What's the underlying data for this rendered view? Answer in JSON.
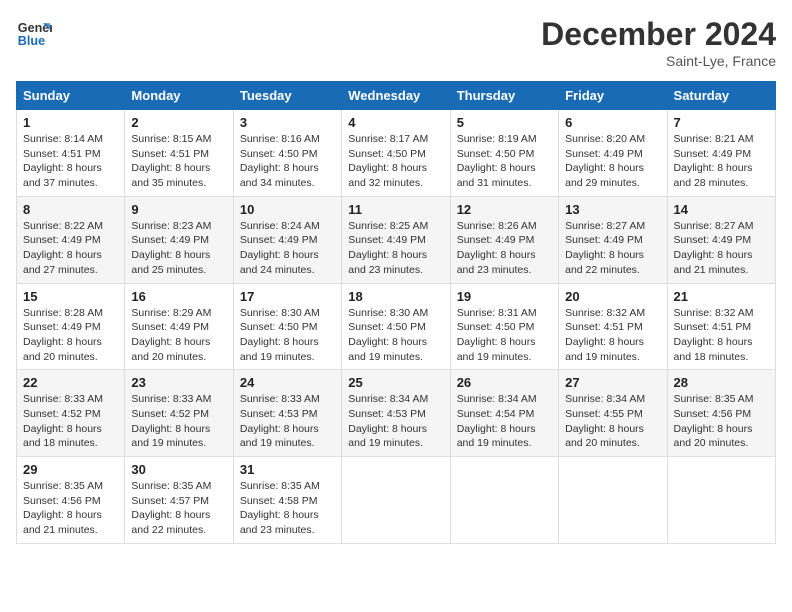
{
  "header": {
    "logo_line1": "General",
    "logo_line2": "Blue",
    "month": "December 2024",
    "location": "Saint-Lye, France"
  },
  "columns": [
    "Sunday",
    "Monday",
    "Tuesday",
    "Wednesday",
    "Thursday",
    "Friday",
    "Saturday"
  ],
  "weeks": [
    [
      {
        "day": "1",
        "lines": [
          "Sunrise: 8:14 AM",
          "Sunset: 4:51 PM",
          "Daylight: 8 hours",
          "and 37 minutes."
        ]
      },
      {
        "day": "2",
        "lines": [
          "Sunrise: 8:15 AM",
          "Sunset: 4:51 PM",
          "Daylight: 8 hours",
          "and 35 minutes."
        ]
      },
      {
        "day": "3",
        "lines": [
          "Sunrise: 8:16 AM",
          "Sunset: 4:50 PM",
          "Daylight: 8 hours",
          "and 34 minutes."
        ]
      },
      {
        "day": "4",
        "lines": [
          "Sunrise: 8:17 AM",
          "Sunset: 4:50 PM",
          "Daylight: 8 hours",
          "and 32 minutes."
        ]
      },
      {
        "day": "5",
        "lines": [
          "Sunrise: 8:19 AM",
          "Sunset: 4:50 PM",
          "Daylight: 8 hours",
          "and 31 minutes."
        ]
      },
      {
        "day": "6",
        "lines": [
          "Sunrise: 8:20 AM",
          "Sunset: 4:49 PM",
          "Daylight: 8 hours",
          "and 29 minutes."
        ]
      },
      {
        "day": "7",
        "lines": [
          "Sunrise: 8:21 AM",
          "Sunset: 4:49 PM",
          "Daylight: 8 hours",
          "and 28 minutes."
        ]
      }
    ],
    [
      {
        "day": "8",
        "lines": [
          "Sunrise: 8:22 AM",
          "Sunset: 4:49 PM",
          "Daylight: 8 hours",
          "and 27 minutes."
        ]
      },
      {
        "day": "9",
        "lines": [
          "Sunrise: 8:23 AM",
          "Sunset: 4:49 PM",
          "Daylight: 8 hours",
          "and 25 minutes."
        ]
      },
      {
        "day": "10",
        "lines": [
          "Sunrise: 8:24 AM",
          "Sunset: 4:49 PM",
          "Daylight: 8 hours",
          "and 24 minutes."
        ]
      },
      {
        "day": "11",
        "lines": [
          "Sunrise: 8:25 AM",
          "Sunset: 4:49 PM",
          "Daylight: 8 hours",
          "and 23 minutes."
        ]
      },
      {
        "day": "12",
        "lines": [
          "Sunrise: 8:26 AM",
          "Sunset: 4:49 PM",
          "Daylight: 8 hours",
          "and 23 minutes."
        ]
      },
      {
        "day": "13",
        "lines": [
          "Sunrise: 8:27 AM",
          "Sunset: 4:49 PM",
          "Daylight: 8 hours",
          "and 22 minutes."
        ]
      },
      {
        "day": "14",
        "lines": [
          "Sunrise: 8:27 AM",
          "Sunset: 4:49 PM",
          "Daylight: 8 hours",
          "and 21 minutes."
        ]
      }
    ],
    [
      {
        "day": "15",
        "lines": [
          "Sunrise: 8:28 AM",
          "Sunset: 4:49 PM",
          "Daylight: 8 hours",
          "and 20 minutes."
        ]
      },
      {
        "day": "16",
        "lines": [
          "Sunrise: 8:29 AM",
          "Sunset: 4:49 PM",
          "Daylight: 8 hours",
          "and 20 minutes."
        ]
      },
      {
        "day": "17",
        "lines": [
          "Sunrise: 8:30 AM",
          "Sunset: 4:50 PM",
          "Daylight: 8 hours",
          "and 19 minutes."
        ]
      },
      {
        "day": "18",
        "lines": [
          "Sunrise: 8:30 AM",
          "Sunset: 4:50 PM",
          "Daylight: 8 hours",
          "and 19 minutes."
        ]
      },
      {
        "day": "19",
        "lines": [
          "Sunrise: 8:31 AM",
          "Sunset: 4:50 PM",
          "Daylight: 8 hours",
          "and 19 minutes."
        ]
      },
      {
        "day": "20",
        "lines": [
          "Sunrise: 8:32 AM",
          "Sunset: 4:51 PM",
          "Daylight: 8 hours",
          "and 19 minutes."
        ]
      },
      {
        "day": "21",
        "lines": [
          "Sunrise: 8:32 AM",
          "Sunset: 4:51 PM",
          "Daylight: 8 hours",
          "and 18 minutes."
        ]
      }
    ],
    [
      {
        "day": "22",
        "lines": [
          "Sunrise: 8:33 AM",
          "Sunset: 4:52 PM",
          "Daylight: 8 hours",
          "and 18 minutes."
        ]
      },
      {
        "day": "23",
        "lines": [
          "Sunrise: 8:33 AM",
          "Sunset: 4:52 PM",
          "Daylight: 8 hours",
          "and 19 minutes."
        ]
      },
      {
        "day": "24",
        "lines": [
          "Sunrise: 8:33 AM",
          "Sunset: 4:53 PM",
          "Daylight: 8 hours",
          "and 19 minutes."
        ]
      },
      {
        "day": "25",
        "lines": [
          "Sunrise: 8:34 AM",
          "Sunset: 4:53 PM",
          "Daylight: 8 hours",
          "and 19 minutes."
        ]
      },
      {
        "day": "26",
        "lines": [
          "Sunrise: 8:34 AM",
          "Sunset: 4:54 PM",
          "Daylight: 8 hours",
          "and 19 minutes."
        ]
      },
      {
        "day": "27",
        "lines": [
          "Sunrise: 8:34 AM",
          "Sunset: 4:55 PM",
          "Daylight: 8 hours",
          "and 20 minutes."
        ]
      },
      {
        "day": "28",
        "lines": [
          "Sunrise: 8:35 AM",
          "Sunset: 4:56 PM",
          "Daylight: 8 hours",
          "and 20 minutes."
        ]
      }
    ],
    [
      {
        "day": "29",
        "lines": [
          "Sunrise: 8:35 AM",
          "Sunset: 4:56 PM",
          "Daylight: 8 hours",
          "and 21 minutes."
        ]
      },
      {
        "day": "30",
        "lines": [
          "Sunrise: 8:35 AM",
          "Sunset: 4:57 PM",
          "Daylight: 8 hours",
          "and 22 minutes."
        ]
      },
      {
        "day": "31",
        "lines": [
          "Sunrise: 8:35 AM",
          "Sunset: 4:58 PM",
          "Daylight: 8 hours",
          "and 23 minutes."
        ]
      },
      null,
      null,
      null,
      null
    ]
  ]
}
